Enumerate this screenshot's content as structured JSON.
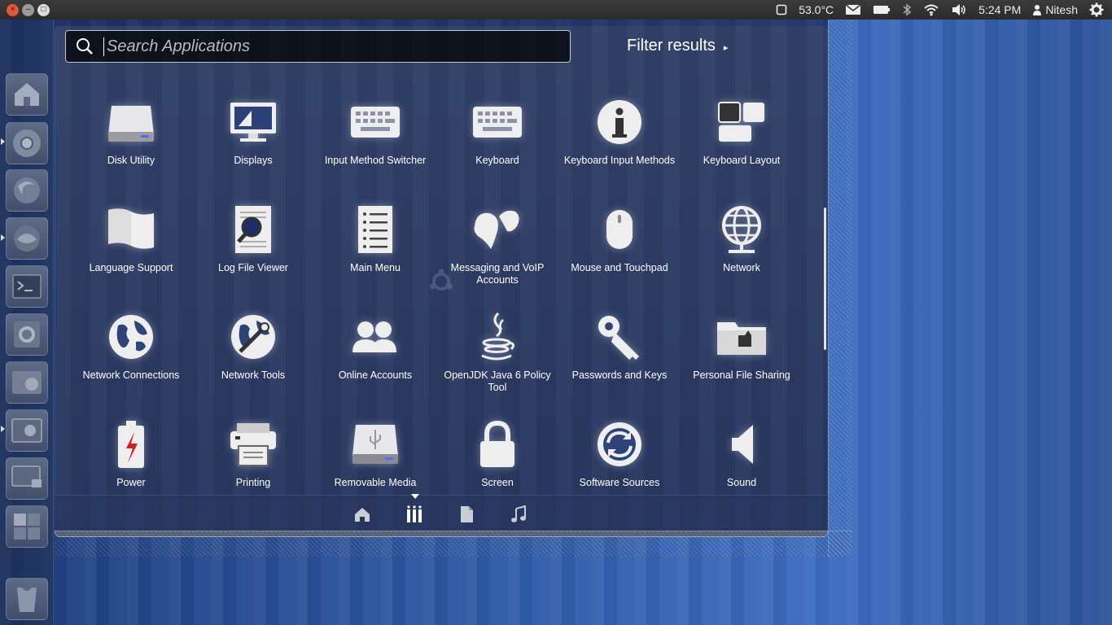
{
  "panel": {
    "window_controls": [
      {
        "name": "close",
        "glyph": "×"
      },
      {
        "name": "minimize",
        "glyph": "–"
      },
      {
        "name": "maximize",
        "glyph": "□"
      }
    ],
    "temperature": "53.0°C",
    "time": "5:24 PM",
    "user": "Nitesh"
  },
  "launcher": {
    "items": [
      "dash-home",
      "files-home",
      "chrome",
      "firefox",
      "thunderbird",
      "terminal",
      "system-settings",
      "disk-manager",
      "shotwell",
      "workspace-switcher",
      "workspaces",
      "trash"
    ]
  },
  "search": {
    "placeholder": "Search Applications",
    "value": ""
  },
  "filter": {
    "label": "Filter results",
    "arrow": "▸"
  },
  "apps": [
    {
      "label": "Disk Utility",
      "icon": "disk-icon"
    },
    {
      "label": "Displays",
      "icon": "display-icon"
    },
    {
      "label": "Input Method Switcher",
      "icon": "keyboard-icon"
    },
    {
      "label": "Keyboard",
      "icon": "keyboard-icon"
    },
    {
      "label": "Keyboard Input Methods",
      "icon": "info-icon"
    },
    {
      "label": "Keyboard Layout",
      "icon": "layout-icon"
    },
    {
      "label": "Language Support",
      "icon": "flag-icon"
    },
    {
      "label": "Log File Viewer",
      "icon": "log-icon"
    },
    {
      "label": "Main Menu",
      "icon": "menu-list-icon"
    },
    {
      "label": "Messaging and VoIP Accounts",
      "icon": "chat-icon"
    },
    {
      "label": "Mouse and Touchpad",
      "icon": "mouse-icon"
    },
    {
      "label": "Network",
      "icon": "network-globe-icon"
    },
    {
      "label": "Network Connections",
      "icon": "globe-icon"
    },
    {
      "label": "Network Tools",
      "icon": "globe-tools-icon"
    },
    {
      "label": "Online Accounts",
      "icon": "users-icon"
    },
    {
      "label": "OpenJDK Java 6 Policy Tool",
      "icon": "java-icon"
    },
    {
      "label": "Passwords and Keys",
      "icon": "key-icon"
    },
    {
      "label": "Personal File Sharing",
      "icon": "folder-share-icon"
    },
    {
      "label": "Power",
      "icon": "battery-icon"
    },
    {
      "label": "Printing",
      "icon": "printer-icon"
    },
    {
      "label": "Removable Media",
      "icon": "usb-drive-icon"
    },
    {
      "label": "Screen",
      "icon": "lock-icon"
    },
    {
      "label": "Software Sources",
      "icon": "refresh-icon"
    },
    {
      "label": "Sound",
      "icon": "speaker-icon"
    }
  ],
  "lenses": [
    "home-lens",
    "applications-lens",
    "files-lens",
    "music-lens"
  ]
}
